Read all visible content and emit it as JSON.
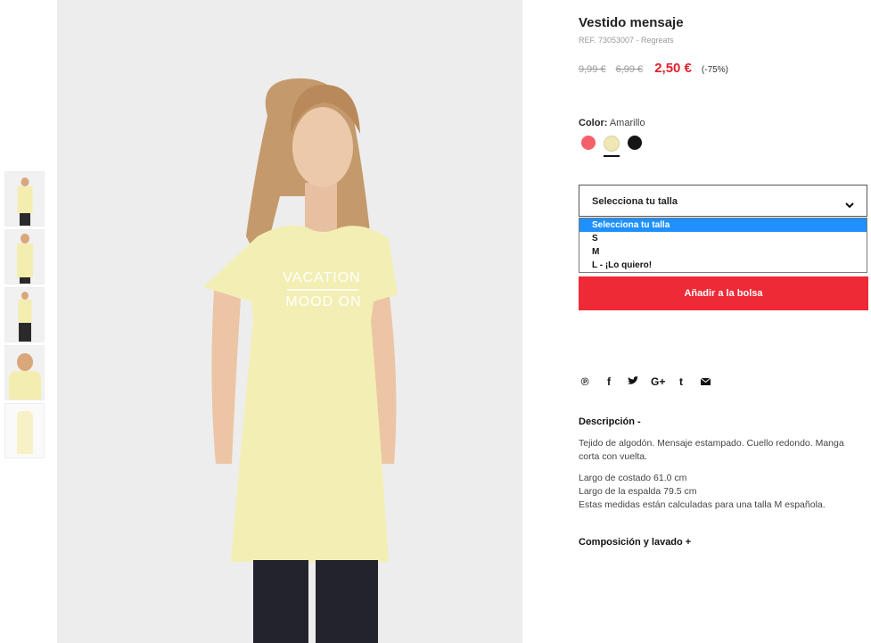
{
  "product": {
    "title": "Vestido mensaje",
    "ref": "REF. 73053007 - Regreats",
    "prices": [
      "9,99 €",
      "6,99 €"
    ],
    "current_price": "2,50 €",
    "discount": "(-75%)"
  },
  "color": {
    "label": "Color:",
    "value": "Amarillo",
    "swatches": [
      "#f5606b",
      "#efe7b5",
      "#151515"
    ]
  },
  "size": {
    "selected": "Selecciona tu talla",
    "options": [
      "Selecciona tu talla",
      "S",
      "M",
      "L - ¡Lo quiero!"
    ]
  },
  "add_button": "Añadir a la bolsa",
  "social_icons": [
    "pinterest-icon",
    "facebook-icon",
    "twitter-icon",
    "google-plus-icon",
    "tumblr-icon",
    "email-icon"
  ],
  "social_glyphs": [
    "℗",
    "f",
    "t",
    "G+",
    "t",
    "✉"
  ],
  "shirt_print": [
    "VACATION",
    "MOOD ON"
  ],
  "description": {
    "title": "Descripción -",
    "p1": "Tejido de algodón. Mensaje estampado. Cuello redondo. Manga corta con vuelta.",
    "p2a": "Largo de costado 61.0 cm",
    "p2b": "Largo de la espalda 79.5 cm",
    "p2c": "Estas medidas están calculadas para una talla M española."
  },
  "composition_title": "Composición y lavado +",
  "colors": {
    "accent": "#ee2a36",
    "price_red": "#e3202e",
    "highlight": "#1e90ff"
  }
}
